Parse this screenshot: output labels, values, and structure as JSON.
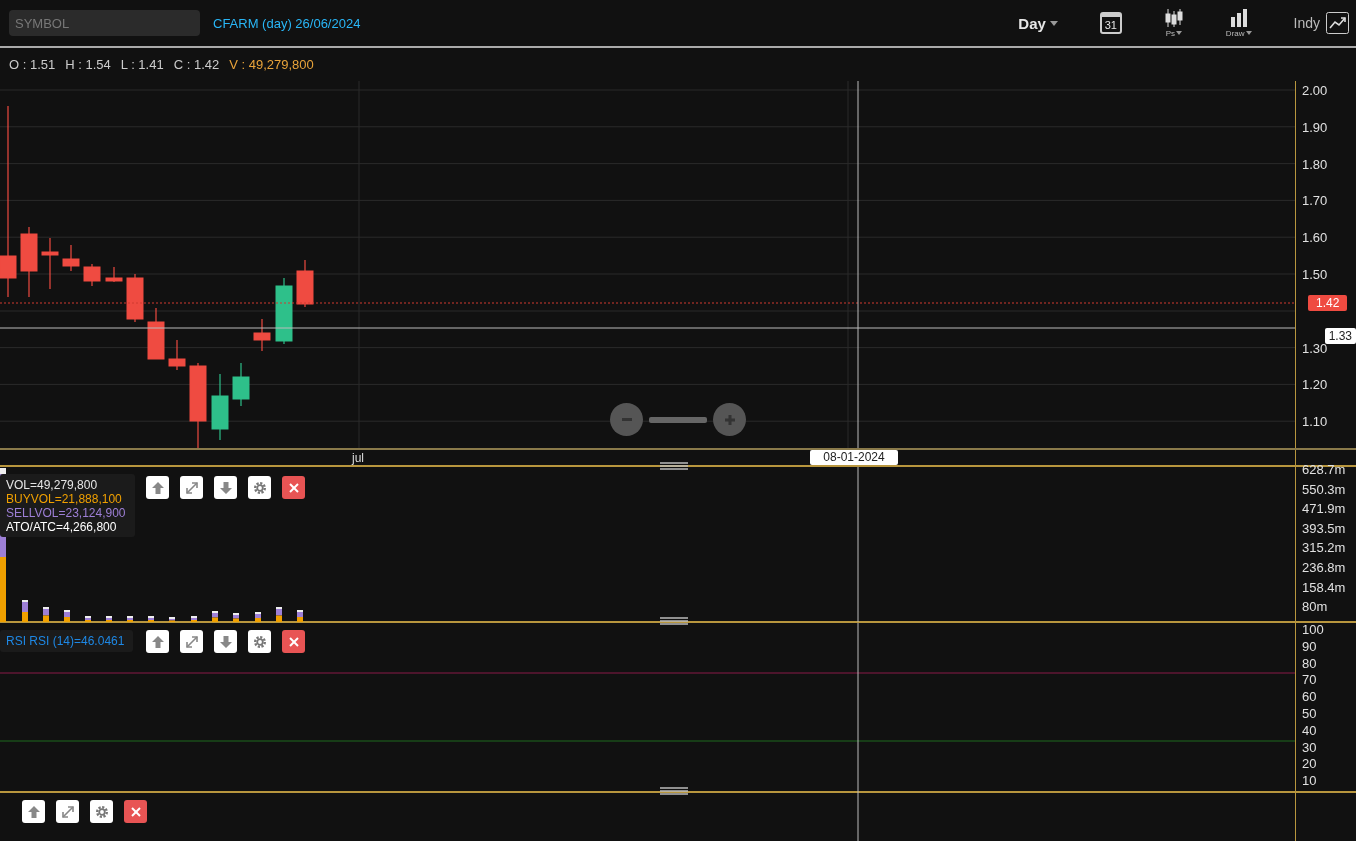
{
  "toolbar": {
    "symbol_field": {
      "placeholder": "SYMBOL"
    },
    "title": "CFARM (day) 26/06/2024",
    "interval": "Day",
    "calendar_day": "31",
    "chart_type_label": "Ps",
    "draw_label": "Draw",
    "indicator_label": "Indy"
  },
  "quote": [
    "O : 1.51",
    "H : 1.54",
    "L : 1.41",
    "C : 1.42"
  ],
  "volume_quote": "V : 49,279,800",
  "price_pane": {
    "ticks": [
      "2.00",
      "1.90",
      "1.80",
      "1.70",
      "1.60",
      "1.50",
      "1.30",
      "1.20",
      "1.10"
    ],
    "last_price": "1.42",
    "crosshair_price": "1.33"
  },
  "x_axis": {
    "labels": [
      "jul"
    ],
    "crosshair_date": "08-01-2024"
  },
  "volume_pane": {
    "legend": [
      {
        "text": "VOL=49,279,800",
        "color": "#e6e6e6"
      },
      {
        "text": "BUYVOL=21,888,100",
        "color": "#f0a000"
      },
      {
        "text": "SELLVOL=23,124,900",
        "color": "#9d7fd6"
      },
      {
        "text": "ATO/ATC=4,266,800",
        "color": "#ffffff"
      }
    ],
    "buttons": [
      {
        "kind": "up"
      },
      {
        "kind": "expand"
      },
      {
        "kind": "down"
      },
      {
        "kind": "settings"
      },
      {
        "kind": "close"
      }
    ],
    "ticks": [
      "628.7m",
      "550.3m",
      "471.9m",
      "393.5m",
      "315.2m",
      "236.8m",
      "158.4m",
      "80m"
    ]
  },
  "rsi_pane": {
    "legend": "RSI RSI (14)=46.0461",
    "buttons": [
      {
        "kind": "up"
      },
      {
        "kind": "expand"
      },
      {
        "kind": "down"
      },
      {
        "kind": "settings"
      },
      {
        "kind": "close"
      }
    ],
    "ticks": [
      "100",
      "90",
      "80",
      "70",
      "60",
      "50",
      "40",
      "30",
      "20",
      "10"
    ]
  },
  "bottom_pane": {
    "buttons": [
      {
        "kind": "up"
      },
      {
        "kind": "expand"
      },
      {
        "kind": "settings"
      },
      {
        "kind": "close"
      }
    ]
  }
}
